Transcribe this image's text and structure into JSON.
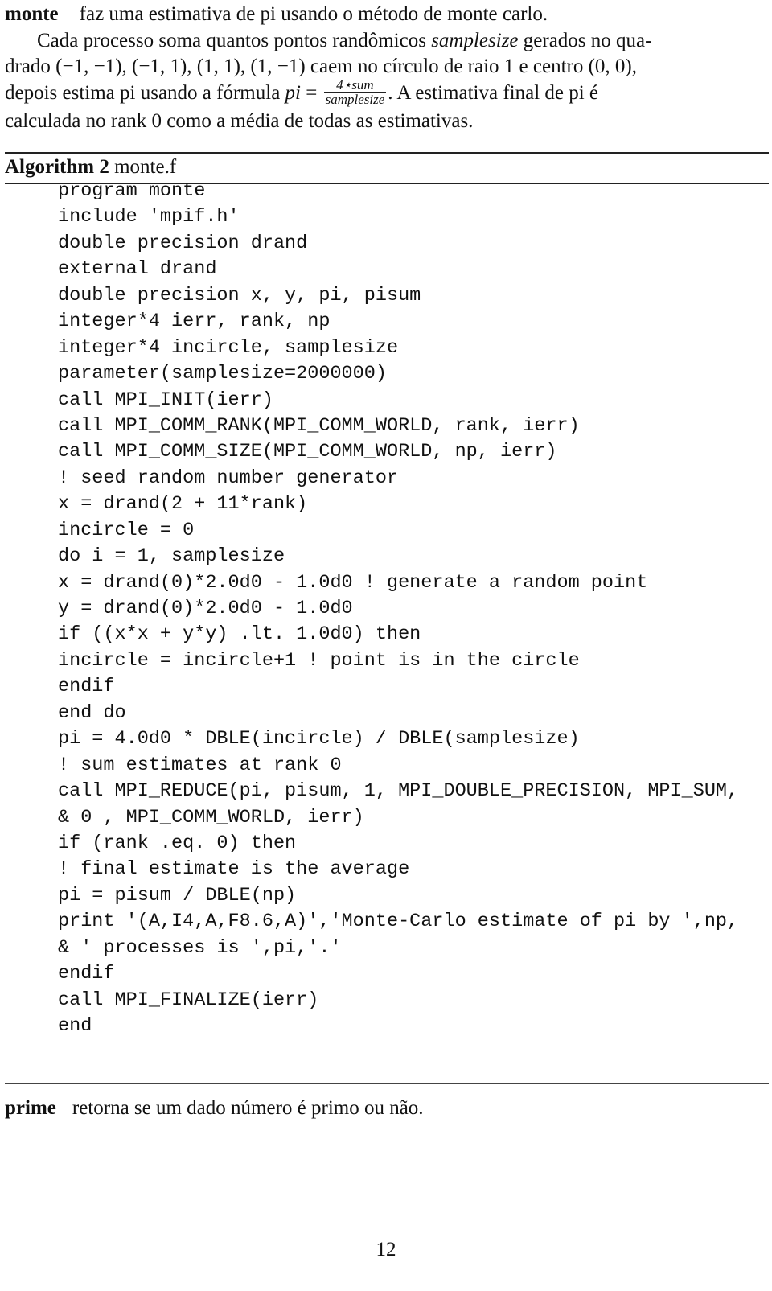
{
  "monte_entry": {
    "term": "monte",
    "summary": "faz uma estimativa de pi usando o método de monte carlo.",
    "desc_part1": "Cada processo soma quantos pontos randômicos ",
    "desc_var": "samplesize",
    "desc_part2": " gerados no qua-",
    "line2": "drado (−1, −1), (−1, 1), (1, 1), (1, −1) caem no círculo de raio 1 e centro (0, 0),",
    "line3_pre": "depois estima pi usando a fórmula ",
    "formula_lhs": "pi",
    "formula_eq": " = ",
    "formula_num": "4⋆sum",
    "formula_den": "samplesize",
    "line3_post": ". A estimativa final de pi é",
    "line4": "calculada no rank 0 como a média de todas as estimativas."
  },
  "algorithm": {
    "label": "Algorithm 2",
    "filename": "monte.f",
    "code_lines": [
      "program monte",
      "include 'mpif.h'",
      "double precision drand",
      "external drand",
      "double precision x, y, pi, pisum",
      "integer*4 ierr, rank, np",
      "integer*4 incircle, samplesize",
      "parameter(samplesize=2000000)",
      "call MPI_INIT(ierr)",
      "call MPI_COMM_RANK(MPI_COMM_WORLD, rank, ierr)",
      "call MPI_COMM_SIZE(MPI_COMM_WORLD, np, ierr)",
      "! seed random number generator",
      "x = drand(2 + 11*rank)",
      "incircle = 0",
      "do i = 1, samplesize",
      "x = drand(0)*2.0d0 - 1.0d0 ! generate a random point",
      "y = drand(0)*2.0d0 - 1.0d0",
      "if ((x*x + y*y) .lt. 1.0d0) then",
      "incircle = incircle+1 ! point is in the circle",
      "endif",
      "end do",
      "pi = 4.0d0 * DBLE(incircle) / DBLE(samplesize)",
      "! sum estimates at rank 0",
      "call MPI_REDUCE(pi, pisum, 1, MPI_DOUBLE_PRECISION, MPI_SUM,",
      "& 0 , MPI_COMM_WORLD, ierr)",
      "if (rank .eq. 0) then",
      "! final estimate is the average",
      "pi = pisum / DBLE(np)",
      "print '(A,I4,A,F8.6,A)','Monte-Carlo estimate of pi by ',np,",
      "& ' processes is ',pi,'.'",
      "endif",
      "call MPI_FINALIZE(ierr)",
      "end"
    ]
  },
  "prime_entry": {
    "term": "prime",
    "summary": "retorna se um dado número é primo ou não."
  },
  "page_number": "12"
}
